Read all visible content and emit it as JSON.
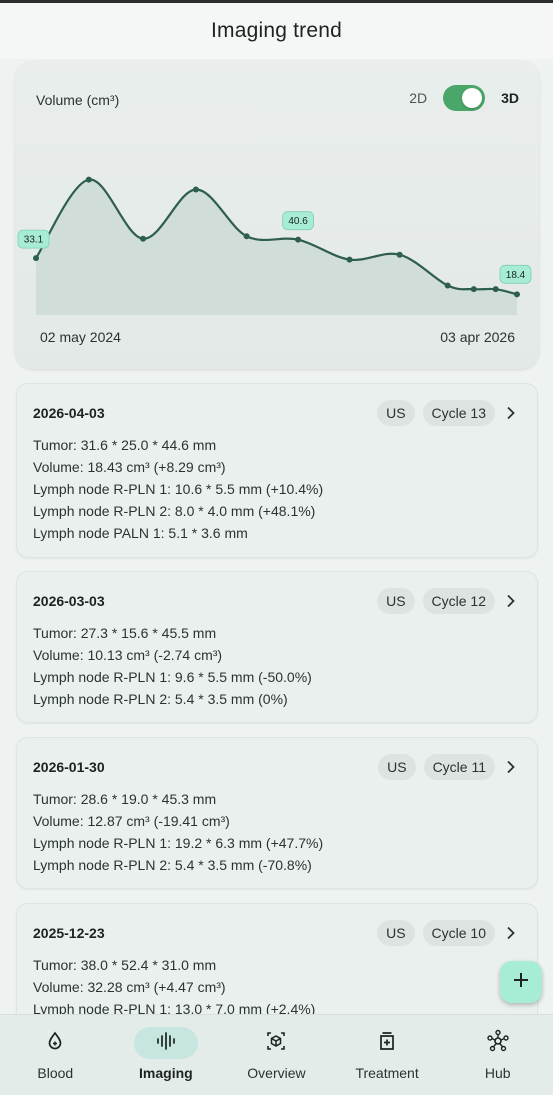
{
  "header": {
    "title": "Imaging trend"
  },
  "chart": {
    "title": "Volume (cm³)",
    "toggle": {
      "left_label": "2D",
      "right_label": "3D",
      "selected": "3D"
    },
    "x_start_label": "02 may 2024",
    "x_end_label": "03 apr 2026",
    "colors": {
      "line": "#2d5e50",
      "fill": "#c9d8d3",
      "badge": "#a7ecd5"
    }
  },
  "chart_data": {
    "type": "area",
    "x": [
      "2024-05-02",
      "2024-07-18",
      "2024-10-05",
      "2024-12-21",
      "2025-03-05",
      "2025-05-19",
      "2025-08-02",
      "2025-10-14",
      "2025-12-23",
      "2026-01-30",
      "2026-03-03",
      "2026-04-03"
    ],
    "values": [
      33.1,
      65,
      41,
      61,
      42,
      40.6,
      32.5,
      34.5,
      22,
      20.5,
      20.5,
      18.4
    ],
    "labeled_points": [
      {
        "index": 0,
        "label": "33.1"
      },
      {
        "index": 5,
        "label": "40.6"
      },
      {
        "index": 11,
        "label": "18.4"
      }
    ],
    "x_labels": [
      "02 may 2024",
      "03 apr 2026"
    ],
    "ylabel": "Volume (cm³)",
    "ylim": [
      10,
      75
    ]
  },
  "entries": [
    {
      "date": "2026-04-03",
      "modality": "US",
      "cycle": "Cycle 13",
      "lines": [
        "Tumor: 31.6 * 25.0 * 44.6 mm",
        "Volume: 18.43 cm³ (+8.29 cm³)",
        "Lymph node R-PLN 1: 10.6 * 5.5 mm (+10.4%)",
        "Lymph node R-PLN 2: 8.0 * 4.0 mm (+48.1%)",
        "Lymph node PALN 1: 5.1 * 3.6 mm"
      ]
    },
    {
      "date": "2026-03-03",
      "modality": "US",
      "cycle": "Cycle 12",
      "lines": [
        "Tumor: 27.3 * 15.6 * 45.5 mm",
        "Volume: 10.13 cm³ (-2.74 cm³)",
        "Lymph node R-PLN 1: 9.6 * 5.5 mm (-50.0%)",
        "Lymph node R-PLN 2: 5.4 * 3.5 mm (0%)"
      ]
    },
    {
      "date": "2026-01-30",
      "modality": "US",
      "cycle": "Cycle 11",
      "lines": [
        "Tumor: 28.6 * 19.0 * 45.3 mm",
        "Volume: 12.87 cm³ (-19.41 cm³)",
        "Lymph node R-PLN 1: 19.2 * 6.3 mm (+47.7%)",
        "Lymph node R-PLN 2: 5.4 * 3.5 mm (-70.8%)"
      ]
    },
    {
      "date": "2025-12-23",
      "modality": "US",
      "cycle": "Cycle 10",
      "lines": [
        "Tumor: 38.0 * 52.4 * 31.0 mm",
        "Volume: 32.28 cm³ (+4.47 cm³)",
        "Lymph node R-PLN 1: 13.0 * 7.0 mm (+2.4%)"
      ]
    }
  ],
  "fab": {
    "icon": "plus-icon"
  },
  "nav": {
    "items": [
      {
        "label": "Blood",
        "icon": "blood-drop-icon"
      },
      {
        "label": "Imaging",
        "icon": "waveform-icon",
        "active": true
      },
      {
        "label": "Overview",
        "icon": "cube-icon"
      },
      {
        "label": "Treatment",
        "icon": "medication-icon"
      },
      {
        "label": "Hub",
        "icon": "hub-icon"
      }
    ]
  }
}
